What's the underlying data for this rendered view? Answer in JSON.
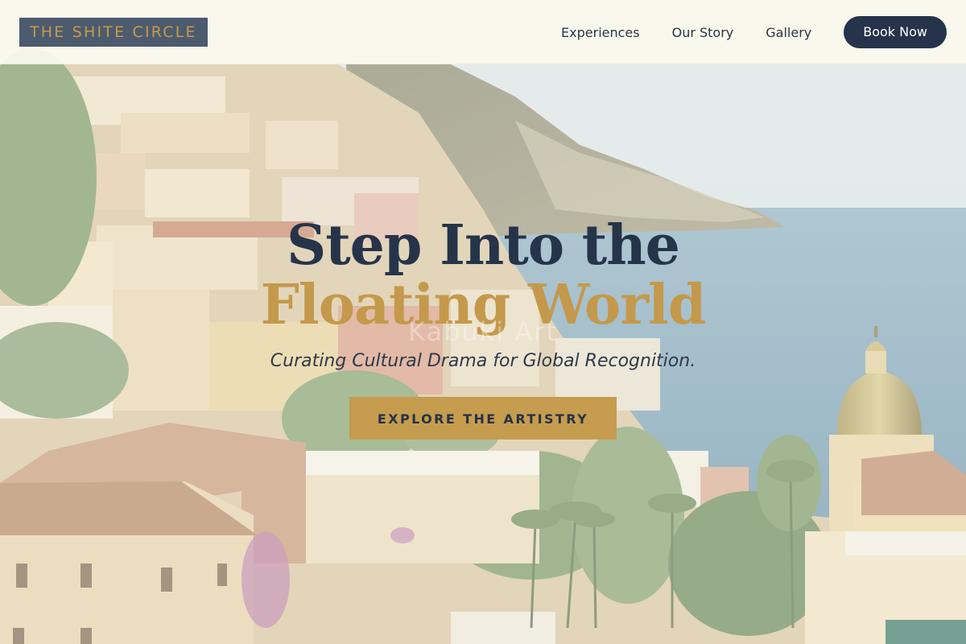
{
  "header": {
    "logo": "THE SHITE CIRCLE",
    "nav": [
      {
        "label": "Experiences"
      },
      {
        "label": "Our Story"
      },
      {
        "label": "Gallery"
      }
    ],
    "book_label": "Book Now"
  },
  "hero": {
    "title_line1": "Step Into the",
    "title_line2": "Floating World",
    "ghost_text": "Kabuki Art",
    "subtitle": "Curating Cultural Drama for Global Recognition.",
    "cta_label": "EXPLORE THE ARTISTRY",
    "background": "coastal cliffside village and sea"
  },
  "colors": {
    "navy": "#26344a",
    "gold": "#c69a4c",
    "header_bg": "#f9f9ec",
    "logo_bg": "#4d5b6e"
  }
}
